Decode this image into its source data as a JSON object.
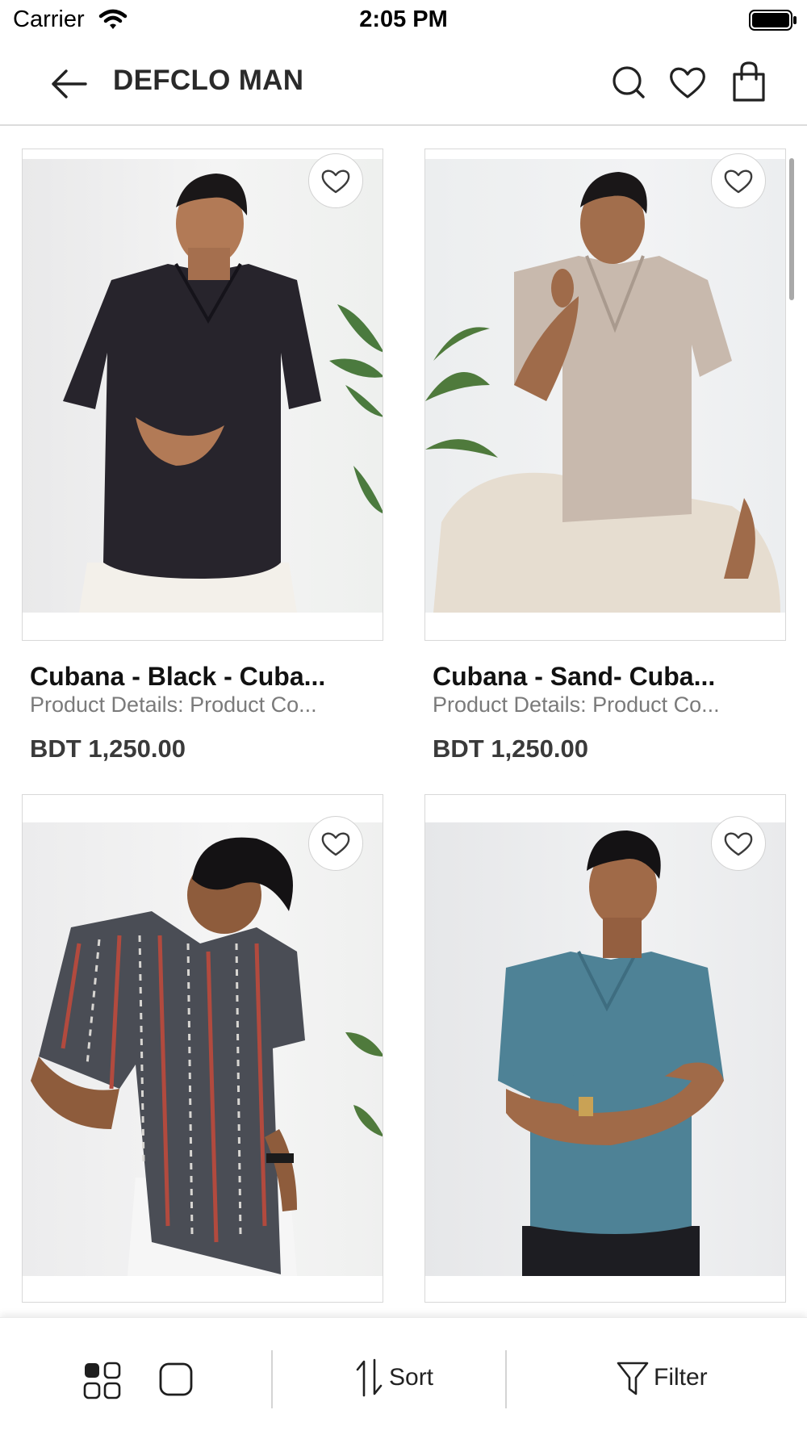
{
  "status_bar": {
    "carrier": "Carrier",
    "time": "2:05 PM"
  },
  "nav": {
    "title": "DEFCLO MAN",
    "icons": [
      "back-arrow-icon",
      "search-icon",
      "heart-icon",
      "shopping-bag-icon"
    ]
  },
  "products": [
    {
      "name": "Cubana - Black - Cuba...",
      "description": "Product Details: Product Co...",
      "price": "BDT 1,250.00",
      "shirt_color": "#27242c",
      "pants_color": "#f3f0ea"
    },
    {
      "name": "Cubana - Sand- Cuba...",
      "description": "Product Details: Product Co...",
      "price": "BDT 1,250.00",
      "shirt_color": "#c8b9ad",
      "pants_color": "#e6ddd0"
    },
    {
      "name": "",
      "description": "",
      "price": "",
      "shirt_color": "#4a4d55",
      "pants_color": "#f6f6f6"
    },
    {
      "name": "",
      "description": "",
      "price": "",
      "shirt_color": "#4e8296",
      "pants_color": "#1d1d22"
    }
  ],
  "bottom_bar": {
    "sort_label": "Sort",
    "filter_label": "Filter"
  },
  "colors": {
    "background": "#ffffff",
    "card_border": "#d8d8d8",
    "price_text": "#3a3a3a",
    "muted_text": "#7a7a7a"
  }
}
